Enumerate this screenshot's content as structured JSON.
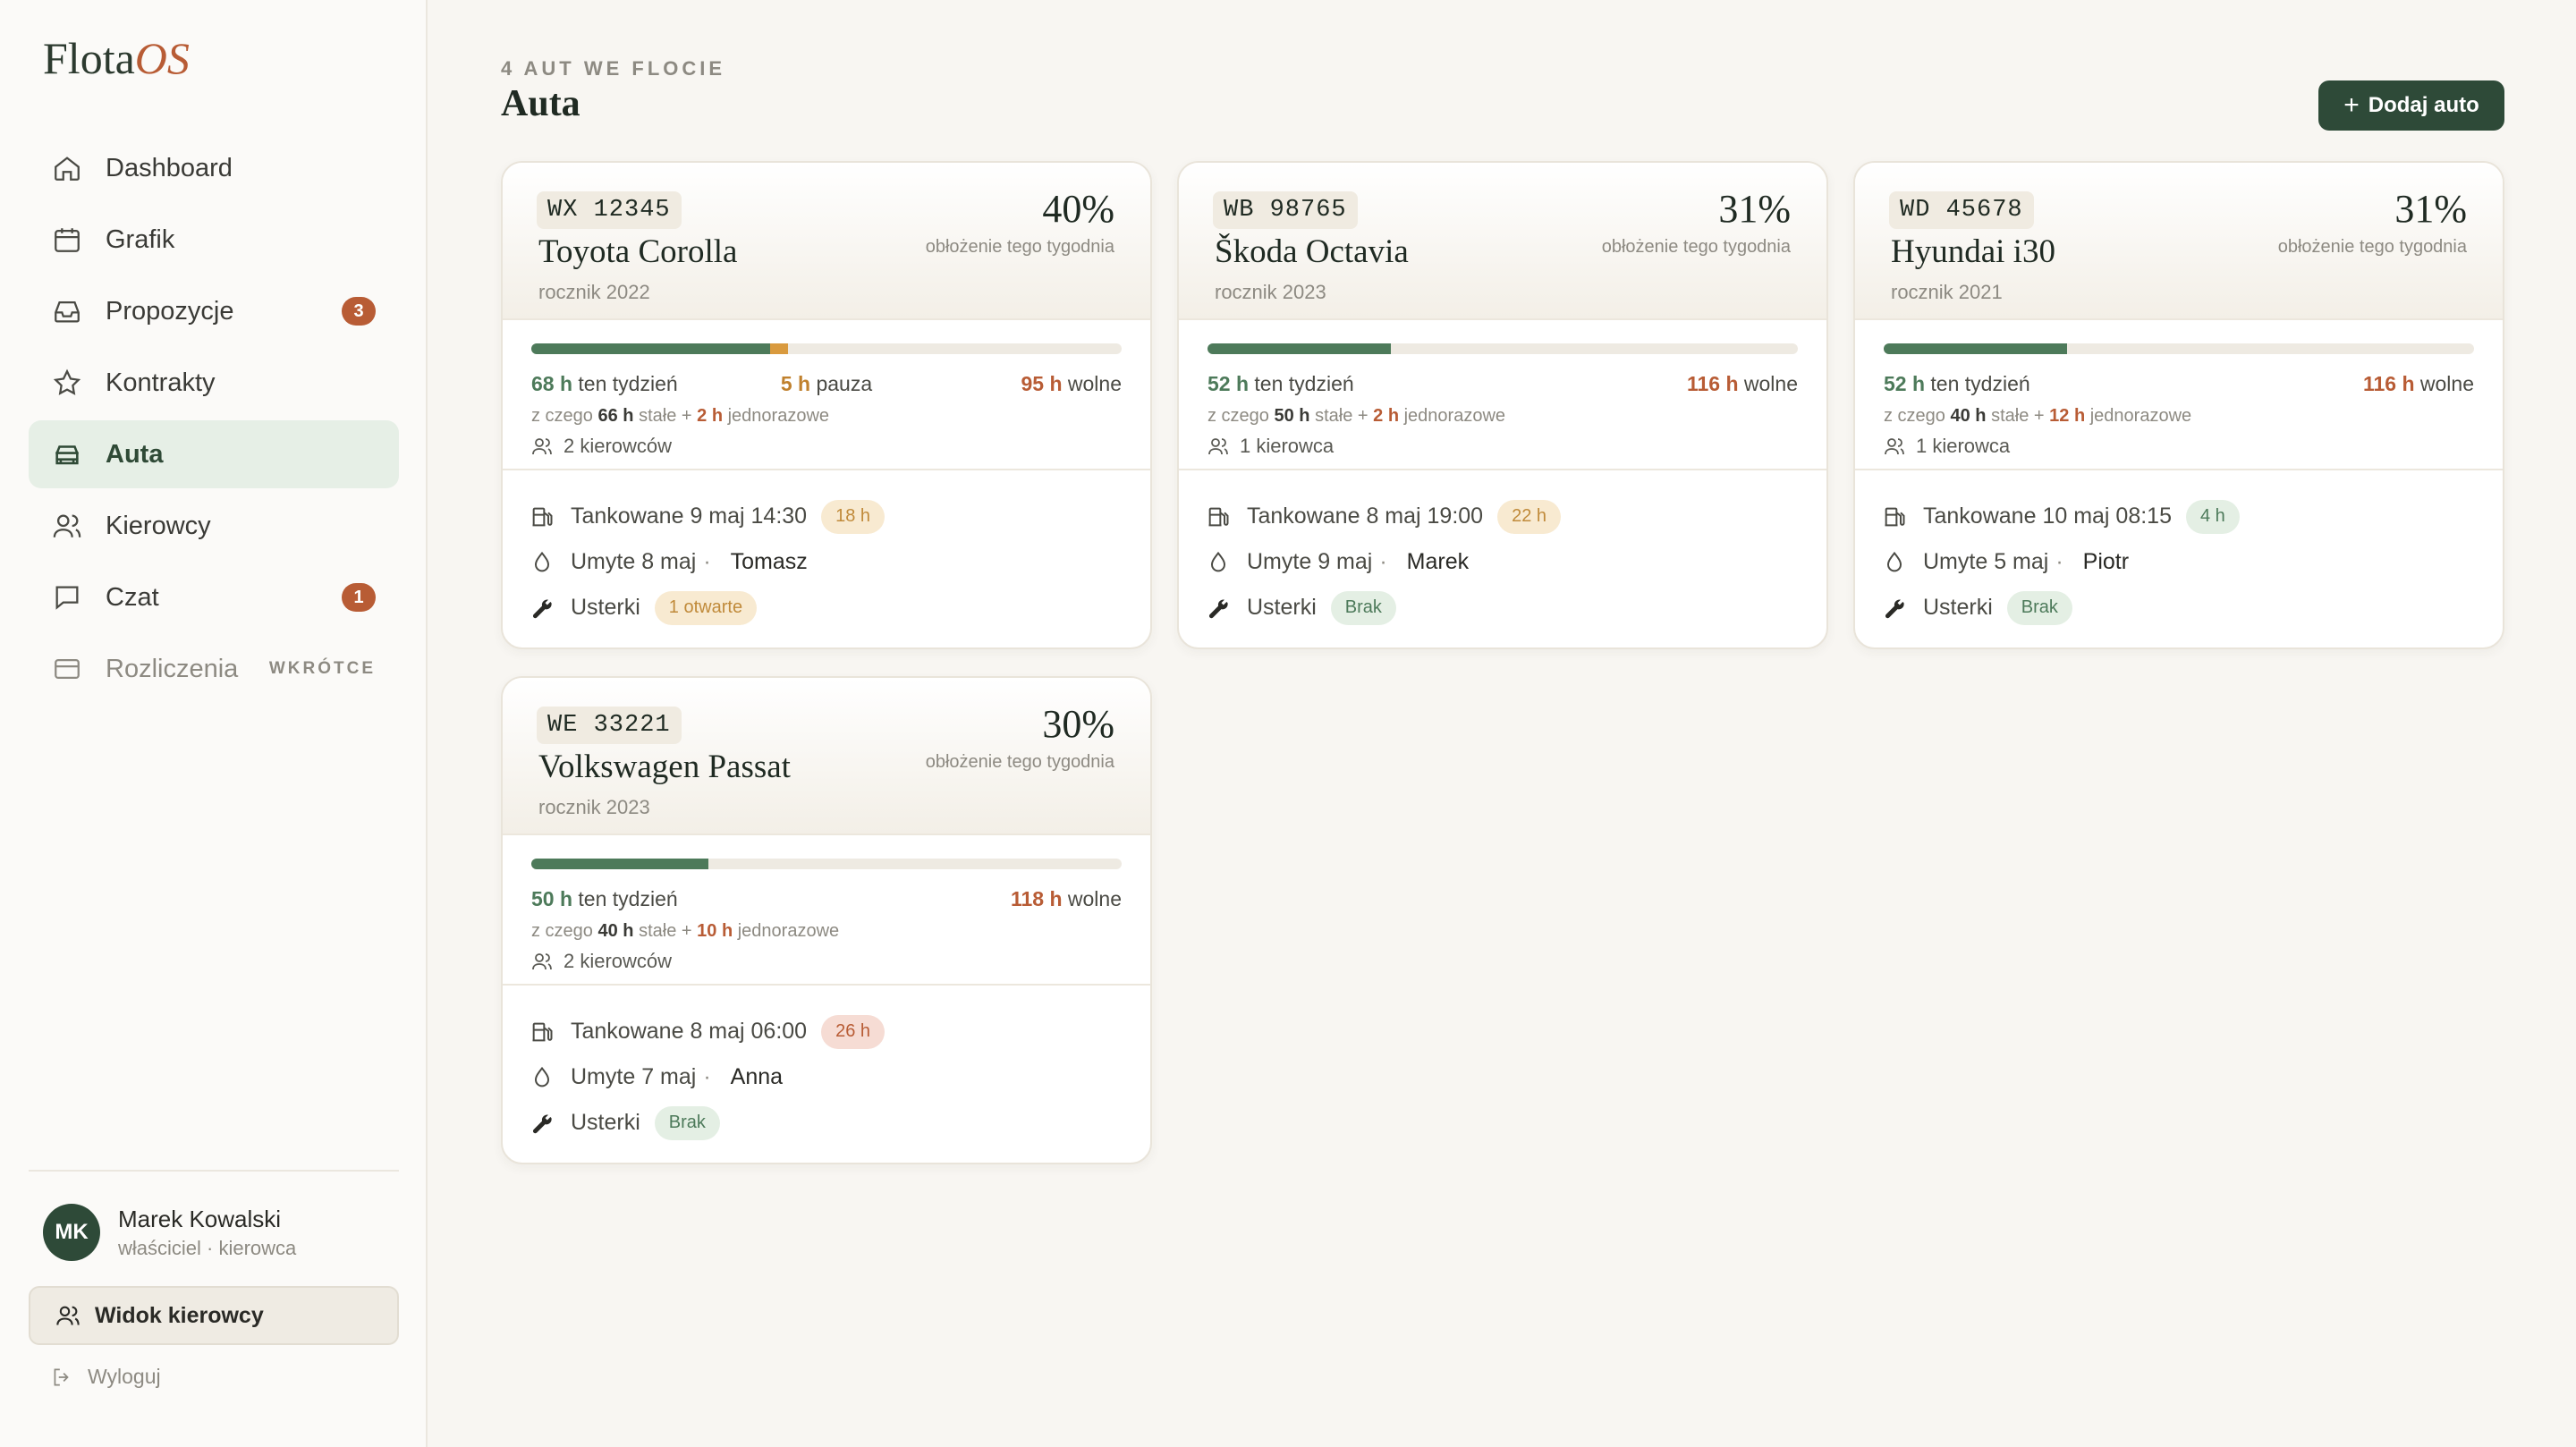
{
  "app": {
    "logo_main": "Flota",
    "logo_accent": "OS"
  },
  "nav": [
    {
      "label": "Dashboard",
      "icon": "home-icon"
    },
    {
      "label": "Grafik",
      "icon": "calendar-icon"
    },
    {
      "label": "Propozycje",
      "icon": "inbox-icon",
      "badge": "3"
    },
    {
      "label": "Kontrakty",
      "icon": "star-icon"
    },
    {
      "label": "Auta",
      "icon": "car-icon",
      "active": true
    },
    {
      "label": "Kierowcy",
      "icon": "users-icon"
    },
    {
      "label": "Czat",
      "icon": "chat-icon",
      "badge": "1"
    },
    {
      "label": "Rozliczenia",
      "icon": "billing-icon",
      "soon": "WKRÓTCE"
    }
  ],
  "user": {
    "initials": "MK",
    "name": "Marek Kowalski",
    "role": "właściciel · kierowca"
  },
  "driver_view_label": "Widok kierowcy",
  "logout_label": "Wyloguj",
  "header": {
    "eyebrow": "4 AUT WE FLOCIE",
    "title": "Auta",
    "add_label": "Dodaj auto"
  },
  "labels": {
    "occupancy": "obłożenie tego tygodnia",
    "this_week": "ten tydzień",
    "pause": "pauza",
    "free": "wolne",
    "of_which": "z czego",
    "fixed": "stałe +",
    "one_time": "jednorazowe",
    "fueled": "Tankowane",
    "washed": "Umyte",
    "faults": "Usterki"
  },
  "cars": [
    {
      "plate": "WX 12345",
      "name": "Toyota Corolla",
      "year": "rocznik 2022",
      "occupancy": "40%",
      "used": "68 h",
      "pause": "5 h",
      "free": "95 h",
      "fixed": "66 h",
      "one_time": "2 h",
      "used_pct": 40.5,
      "pause_pct": 3.0,
      "drivers": "2 kierowców",
      "fueled": "9 maj 14:30",
      "fuel_ago": "18 h",
      "fuel_level": "warn",
      "washed": "8 maj",
      "washed_by": "Tomasz",
      "faults": "1 otwarte",
      "fault_level": "warn"
    },
    {
      "plate": "WB 98765",
      "name": "Škoda Octavia",
      "year": "rocznik 2023",
      "occupancy": "31%",
      "used": "52 h",
      "free": "116 h",
      "fixed": "50 h",
      "one_time": "2 h",
      "used_pct": 31.0,
      "pause_pct": 0,
      "drivers": "1 kierowca",
      "fueled": "8 maj 19:00",
      "fuel_ago": "22 h",
      "fuel_level": "warn",
      "washed": "9 maj",
      "washed_by": "Marek",
      "faults": "Brak",
      "fault_level": "ok"
    },
    {
      "plate": "WD 45678",
      "name": "Hyundai i30",
      "year": "rocznik 2021",
      "occupancy": "31%",
      "used": "52 h",
      "free": "116 h",
      "fixed": "40 h",
      "one_time": "12 h",
      "used_pct": 31.0,
      "pause_pct": 0,
      "drivers": "1 kierowca",
      "fueled": "10 maj 08:15",
      "fuel_ago": "4 h",
      "fuel_level": "ok",
      "washed": "5 maj",
      "washed_by": "Piotr",
      "faults": "Brak",
      "fault_level": "ok"
    },
    {
      "plate": "WE 33221",
      "name": "Volkswagen Passat",
      "year": "rocznik 2023",
      "occupancy": "30%",
      "used": "50 h",
      "free": "118 h",
      "fixed": "40 h",
      "one_time": "10 h",
      "used_pct": 30.0,
      "pause_pct": 0,
      "drivers": "2 kierowców",
      "fueled": "8 maj 06:00",
      "fuel_ago": "26 h",
      "fuel_level": "bad",
      "washed": "7 maj",
      "washed_by": "Anna",
      "faults": "Brak",
      "fault_level": "ok"
    }
  ]
}
